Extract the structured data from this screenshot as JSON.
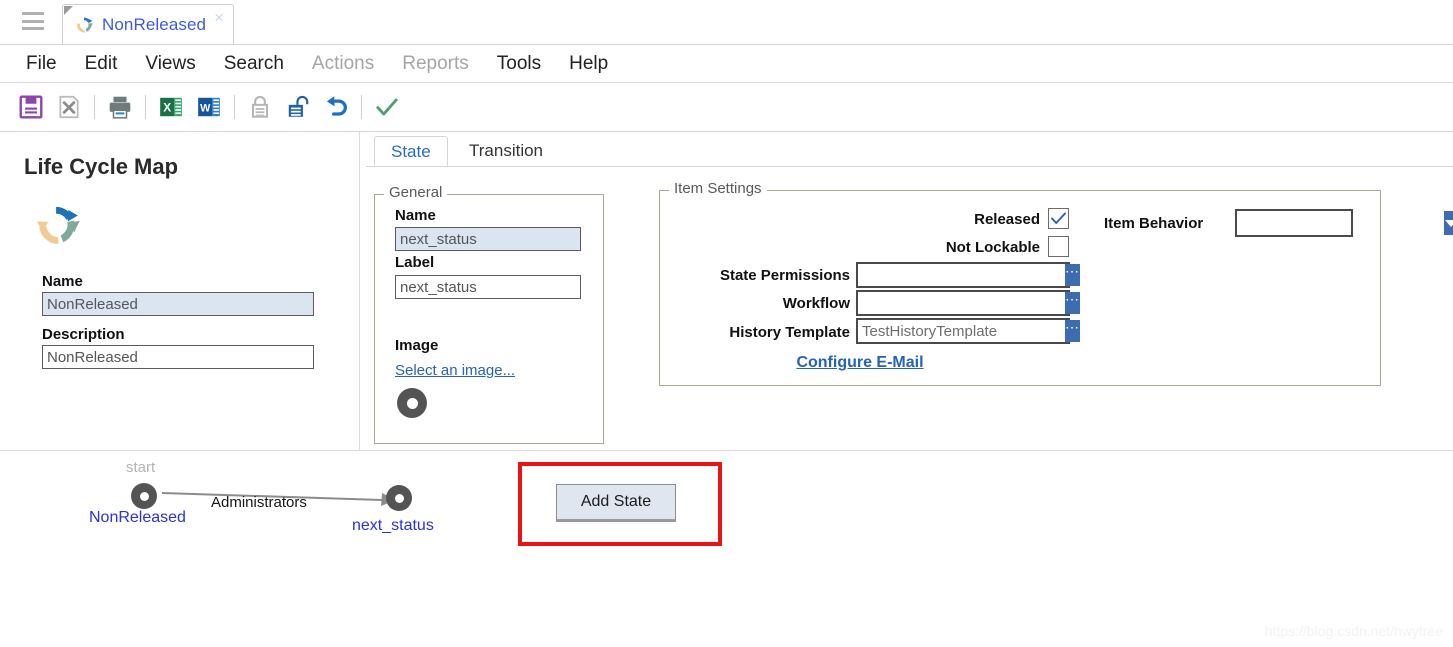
{
  "window": {
    "hamburger_icon": "hamburger-menu-icon",
    "tab": {
      "title": "NonReleased",
      "icon": "lifecycle-recycle-icon",
      "close_label": "×"
    }
  },
  "menubar": {
    "items": [
      {
        "label": "File",
        "disabled": false
      },
      {
        "label": "Edit",
        "disabled": false
      },
      {
        "label": "Views",
        "disabled": false
      },
      {
        "label": "Search",
        "disabled": false
      },
      {
        "label": "Actions",
        "disabled": true
      },
      {
        "label": "Reports",
        "disabled": true
      },
      {
        "label": "Tools",
        "disabled": false
      },
      {
        "label": "Help",
        "disabled": false
      }
    ]
  },
  "toolbar": {
    "buttons": [
      {
        "name": "save-icon",
        "title": "Save"
      },
      {
        "name": "delete-icon",
        "title": "Delete"
      },
      {
        "name": "print-icon",
        "title": "Print"
      },
      {
        "name": "export-excel-icon",
        "title": "Export to Excel"
      },
      {
        "name": "export-word-icon",
        "title": "Export to Word"
      },
      {
        "name": "lock-icon",
        "title": "Lock"
      },
      {
        "name": "unlock-icon",
        "title": "Unlock"
      },
      {
        "name": "undo-icon",
        "title": "Undo"
      },
      {
        "name": "check-icon",
        "title": "Apply"
      }
    ]
  },
  "left_panel": {
    "title": "Life Cycle Map",
    "icon": "lifecycle-recycle-icon",
    "name_label": "Name",
    "name_value": "NonReleased",
    "description_label": "Description",
    "description_value": "NonReleased"
  },
  "tabs": [
    {
      "label": "State",
      "active": true
    },
    {
      "label": "Transition",
      "active": false
    }
  ],
  "general": {
    "legend": "General",
    "name_label": "Name",
    "name_value": "next_status",
    "label_label": "Label",
    "label_value": "next_status",
    "image_label": "Image",
    "select_image_link": "Select an image...",
    "image_preview_icon": "state-donut-icon"
  },
  "item_settings": {
    "legend": "Item Settings",
    "released_label": "Released",
    "released_checked": true,
    "not_lockable_label": "Not Lockable",
    "not_lockable_checked": false,
    "rows": [
      {
        "label": "State Permissions",
        "value": "",
        "button_icon": "ellipsis-icon"
      },
      {
        "label": "Workflow",
        "value": "",
        "button_icon": "ellipsis-icon"
      },
      {
        "label": "History Template",
        "value": "TestHistoryTemplate",
        "button_icon": "ellipsis-icon"
      }
    ],
    "configure_email_link": "Configure E-Mail"
  },
  "item_behavior": {
    "label": "Item Behavior",
    "value": "",
    "arrow_icon": "chevron-down-icon"
  },
  "diagram": {
    "start_label": "start",
    "nodes": [
      {
        "label": "NonReleased",
        "icon": "state-donut-icon"
      },
      {
        "label": "next_status",
        "icon": "state-donut-icon"
      }
    ],
    "edge_label": "Administrators",
    "add_state_button": "Add State"
  },
  "watermark": "https://blog.csdn.net/hwytree",
  "colors": {
    "accent_blue": "#3f6bb0",
    "link_blue": "#2861b8",
    "tab_blue": "#3b5bdb",
    "node_blue": "#2b32d6",
    "highlight_red": "#ee1111",
    "selected_field": "#dbe5f1",
    "groupbox_border": "#aba794"
  }
}
